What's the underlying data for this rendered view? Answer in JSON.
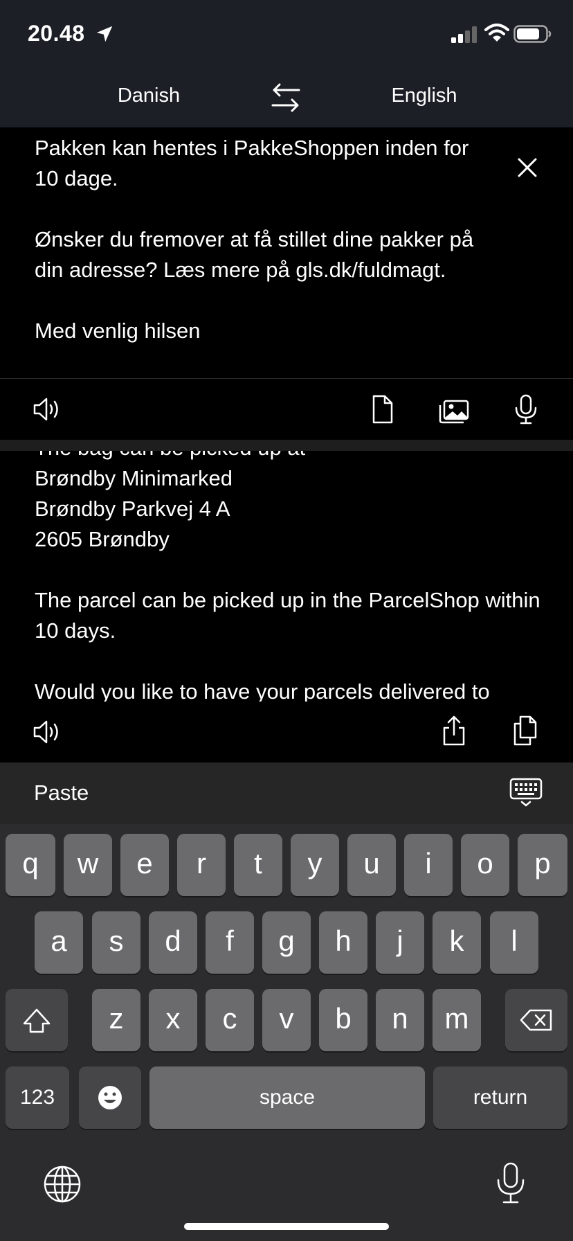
{
  "status": {
    "time": "20.48"
  },
  "languages": {
    "source": "Danish",
    "target": "English"
  },
  "source_text": "Pakken kan hentes i PakkeShoppen inden for 10 dage.\n\nØnsker du fremover at få stillet dine pakker på din adresse? Læs mere på gls.dk/fuldmagt.\n\nMed venlig hilsen",
  "target_text": "The bag can be picked up at\nBrøndby Minimarked\nBrøndby Parkvej 4 A\n2605 Brøndby\n\nThe parcel can be picked up in the ParcelShop within 10 days.\n\nWould you like to have your parcels delivered to",
  "paste_bar": {
    "label": "Paste"
  },
  "keyboard": {
    "row1": [
      "q",
      "w",
      "e",
      "r",
      "t",
      "y",
      "u",
      "i",
      "o",
      "p"
    ],
    "row2": [
      "a",
      "s",
      "d",
      "f",
      "g",
      "h",
      "j",
      "k",
      "l"
    ],
    "row3": [
      "z",
      "x",
      "c",
      "v",
      "b",
      "n",
      "m"
    ],
    "numbers_key": "123",
    "space_key": "space",
    "return_key": "return"
  },
  "icons": {
    "location": "location-arrow-icon",
    "swap": "swap-arrows-icon",
    "close": "close-icon",
    "speaker": "speaker-icon",
    "document": "document-icon",
    "photo": "photo-icon",
    "mic": "microphone-icon",
    "share": "share-icon",
    "copy": "copy-icon",
    "keyboard": "keyboard-icon",
    "globe": "globe-icon"
  },
  "colors": {
    "header_bg": "#1c1f26",
    "key": "#6b6b6d",
    "key_dark": "#464648",
    "keyboard_bg": "#2c2c2e"
  }
}
